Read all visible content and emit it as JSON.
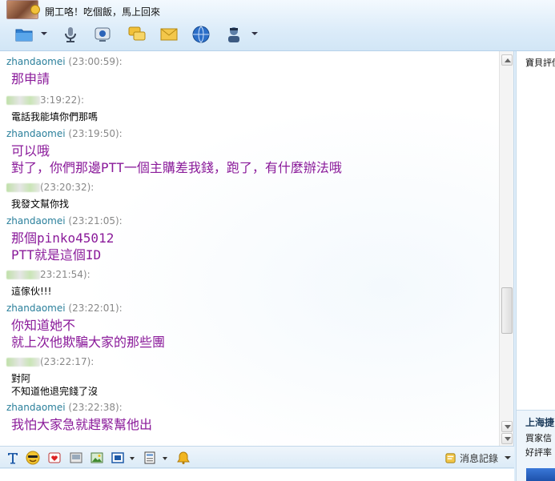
{
  "status_message": "開工咯！吃個飯，馬上回來",
  "toolbar_icons": [
    "folder-icon",
    "microphone-icon",
    "webcam-icon",
    "chat-bubbles-icon",
    "envelope-icon",
    "globe-icon",
    "agent-icon"
  ],
  "messages": [
    {
      "sender": "zhandaomei",
      "time": "(23:00:59):",
      "self": true,
      "lines": [
        "那申請"
      ]
    },
    {
      "sender": "",
      "time": "3:19:22):",
      "self": false,
      "lines": [
        "電話我能填你們那嗎"
      ]
    },
    {
      "sender": "zhandaomei",
      "time": "(23:19:50):",
      "self": true,
      "lines": [
        "可以哦",
        "對了，你們那邊PTT一個主購差我錢，跑了，有什麼辦法哦"
      ]
    },
    {
      "sender": "",
      "time": "(23:20:32):",
      "self": false,
      "lines": [
        "我發文幫你找"
      ]
    },
    {
      "sender": "zhandaomei",
      "time": "(23:21:05):",
      "self": true,
      "lines": [
        "那個pinko45012",
        "PTT就是這個ID"
      ]
    },
    {
      "sender": "",
      "time": "23:21:54):",
      "self": false,
      "lines": [
        "這傢伙!!!"
      ]
    },
    {
      "sender": "zhandaomei",
      "time": "(23:22:01):",
      "self": true,
      "lines": [
        "你知道她不",
        "就上次他欺騙大家的那些團"
      ]
    },
    {
      "sender": "",
      "time": "(23:22:17):",
      "self": false,
      "lines": [
        "對阿",
        "不知道他退完錢了沒"
      ]
    },
    {
      "sender": "zhandaomei",
      "time": "(23:22:38):",
      "self": true,
      "lines": [
        "我怕大家急就趕緊幫他出"
      ]
    }
  ],
  "input_toolbar": {
    "icons": [
      "font-style-icon",
      "emoticon-icon",
      "gift-icon",
      "screenshot-icon",
      "image-icon",
      "screen-capture-icon",
      "layout-icon",
      "bell-icon"
    ],
    "history_label": "消息記錄"
  },
  "right_panel": {
    "top_text": "寶貝評價",
    "shop_title": "上海捷",
    "line1": "買家信",
    "line2": "好評率"
  }
}
